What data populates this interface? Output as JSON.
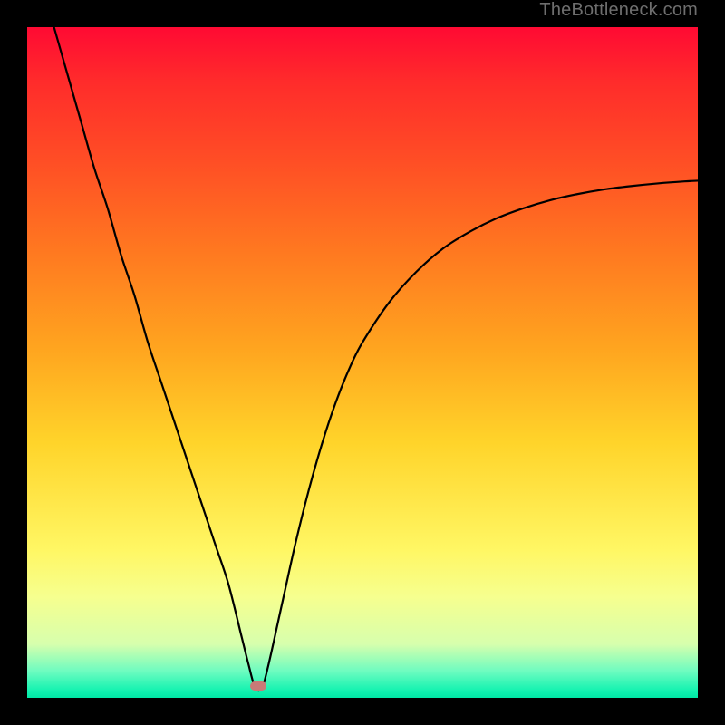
{
  "watermark": "TheBottleneck.com",
  "chart_data": {
    "type": "line",
    "title": "",
    "xlabel": "",
    "ylabel": "",
    "xlim": [
      0,
      100
    ],
    "ylim": [
      0,
      100
    ],
    "series": [
      {
        "name": "curve",
        "x": [
          4,
          6,
          8,
          10,
          12,
          14,
          16,
          18,
          20,
          22,
          24,
          26,
          28,
          30,
          32,
          33,
          34,
          35,
          36,
          38,
          40,
          42,
          44,
          46,
          48,
          50,
          54,
          58,
          62,
          66,
          70,
          74,
          78,
          82,
          86,
          90,
          94,
          98,
          100
        ],
        "y": [
          100,
          93,
          86,
          79,
          73,
          66,
          60,
          53,
          47,
          41,
          35,
          29,
          23,
          17,
          9,
          5,
          1.5,
          1.5,
          5,
          14,
          23,
          31,
          38,
          44,
          49,
          53,
          59,
          63.5,
          67,
          69.5,
          71.5,
          73,
          74.2,
          75.1,
          75.8,
          76.3,
          76.7,
          77.0,
          77.1
        ]
      }
    ],
    "marker": {
      "x": 34.5,
      "y": 1.7
    },
    "colors": {
      "curve": "#000000",
      "marker": "#c97a77",
      "gradient_top": "#ff0a33",
      "gradient_bottom": "#00e8a6"
    }
  }
}
